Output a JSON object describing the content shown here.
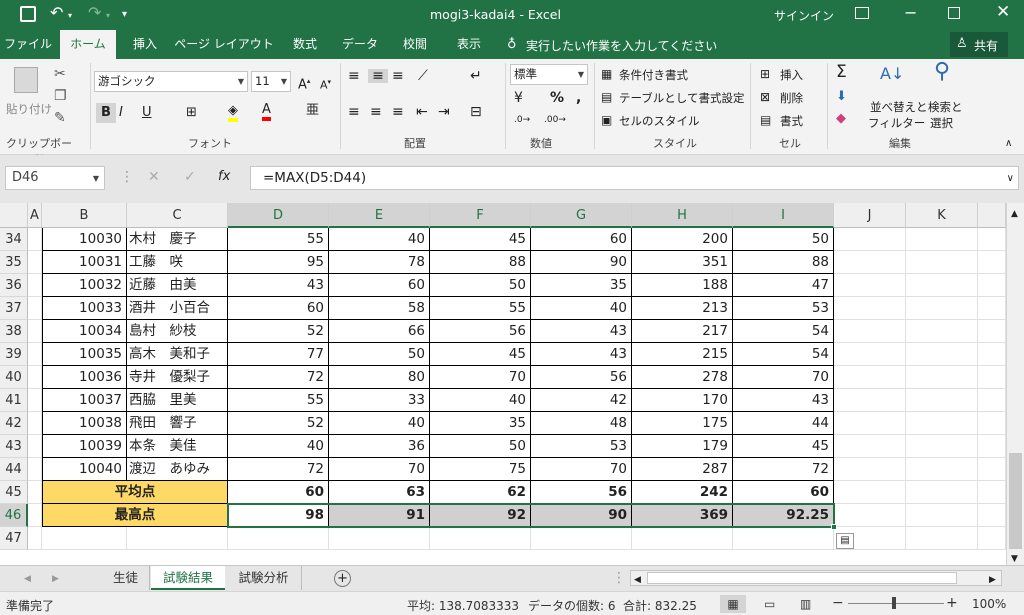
{
  "title_bar": {
    "title": "mogi3-kadai4  -  Excel",
    "signin": "サインイン"
  },
  "tabs": [
    "ファイル",
    "ホーム",
    "挿入",
    "ページ レイアウト",
    "数式",
    "データ",
    "校閲",
    "表示"
  ],
  "tell_me": "実行したい作業を入力してください",
  "share": "共有",
  "ribbon": {
    "clipboard": {
      "paste": "貼り付け",
      "label": "クリップボード"
    },
    "font": {
      "name": "游ゴシック",
      "size": "11",
      "label": "フォント"
    },
    "alignment": {
      "label": "配置"
    },
    "number": {
      "format": "標準",
      "label": "数値"
    },
    "styles": {
      "cond": "条件付き書式",
      "table": "テーブルとして書式設定",
      "cell": "セルのスタイル",
      "label": "スタイル"
    },
    "cells": {
      "insert": "挿入",
      "delete": "削除",
      "format": "書式",
      "label": "セル"
    },
    "editing": {
      "sort1": "並べ替えと",
      "sort2": "フィルター",
      "find1": "検索と",
      "find2": "選択",
      "label": "編集"
    }
  },
  "formula_bar": {
    "name_box": "D46",
    "formula": "=MAX(D5:D44)",
    "fx": "fx"
  },
  "columns": [
    "A",
    "B",
    "C",
    "D",
    "E",
    "F",
    "G",
    "H",
    "I",
    "J",
    "K"
  ],
  "rows": [
    {
      "r": "34",
      "id": "10030",
      "name": "木村　慶子",
      "d": "55",
      "e": "40",
      "f": "45",
      "g": "60",
      "h": "200",
      "i": "50"
    },
    {
      "r": "35",
      "id": "10031",
      "name": "工藤　咲",
      "d": "95",
      "e": "78",
      "f": "88",
      "g": "90",
      "h": "351",
      "i": "88"
    },
    {
      "r": "36",
      "id": "10032",
      "name": "近藤　由美",
      "d": "43",
      "e": "60",
      "f": "50",
      "g": "35",
      "h": "188",
      "i": "47"
    },
    {
      "r": "37",
      "id": "10033",
      "name": "酒井　小百合",
      "d": "60",
      "e": "58",
      "f": "55",
      "g": "40",
      "h": "213",
      "i": "53"
    },
    {
      "r": "38",
      "id": "10034",
      "name": "島村　紗枝",
      "d": "52",
      "e": "66",
      "f": "56",
      "g": "43",
      "h": "217",
      "i": "54"
    },
    {
      "r": "39",
      "id": "10035",
      "name": "高木　美和子",
      "d": "77",
      "e": "50",
      "f": "45",
      "g": "43",
      "h": "215",
      "i": "54"
    },
    {
      "r": "40",
      "id": "10036",
      "name": "寺井　優梨子",
      "d": "72",
      "e": "80",
      "f": "70",
      "g": "56",
      "h": "278",
      "i": "70"
    },
    {
      "r": "41",
      "id": "10037",
      "name": "西脇　里美",
      "d": "55",
      "e": "33",
      "f": "40",
      "g": "42",
      "h": "170",
      "i": "43"
    },
    {
      "r": "42",
      "id": "10038",
      "name": "飛田　響子",
      "d": "52",
      "e": "40",
      "f": "35",
      "g": "48",
      "h": "175",
      "i": "44"
    },
    {
      "r": "43",
      "id": "10039",
      "name": "本条　美佳",
      "d": "40",
      "e": "36",
      "f": "50",
      "g": "53",
      "h": "179",
      "i": "45"
    },
    {
      "r": "44",
      "id": "10040",
      "name": "渡辺　あゆみ",
      "d": "72",
      "e": "70",
      "f": "75",
      "g": "70",
      "h": "287",
      "i": "72"
    }
  ],
  "avg_row": {
    "r": "45",
    "label": "平均点",
    "d": "60",
    "e": "63",
    "f": "62",
    "g": "56",
    "h": "242",
    "i": "60"
  },
  "max_row": {
    "r": "46",
    "label": "最高点",
    "d": "98",
    "e": "91",
    "f": "92",
    "g": "90",
    "h": "369",
    "i": "92.25"
  },
  "empty_row": {
    "r": "47"
  },
  "sheets": [
    "生徒",
    "試験結果",
    "試験分析"
  ],
  "active_sheet": "試験結果",
  "status": {
    "ready": "準備完了",
    "average": "平均: 138.7083333",
    "count": "データの個数: 6",
    "sum": "合計: 832.25",
    "zoom": "100%"
  },
  "colors": {
    "accent": "#217346",
    "label_fill": "#ffd966",
    "selected_fill": "#d0d0d0"
  }
}
